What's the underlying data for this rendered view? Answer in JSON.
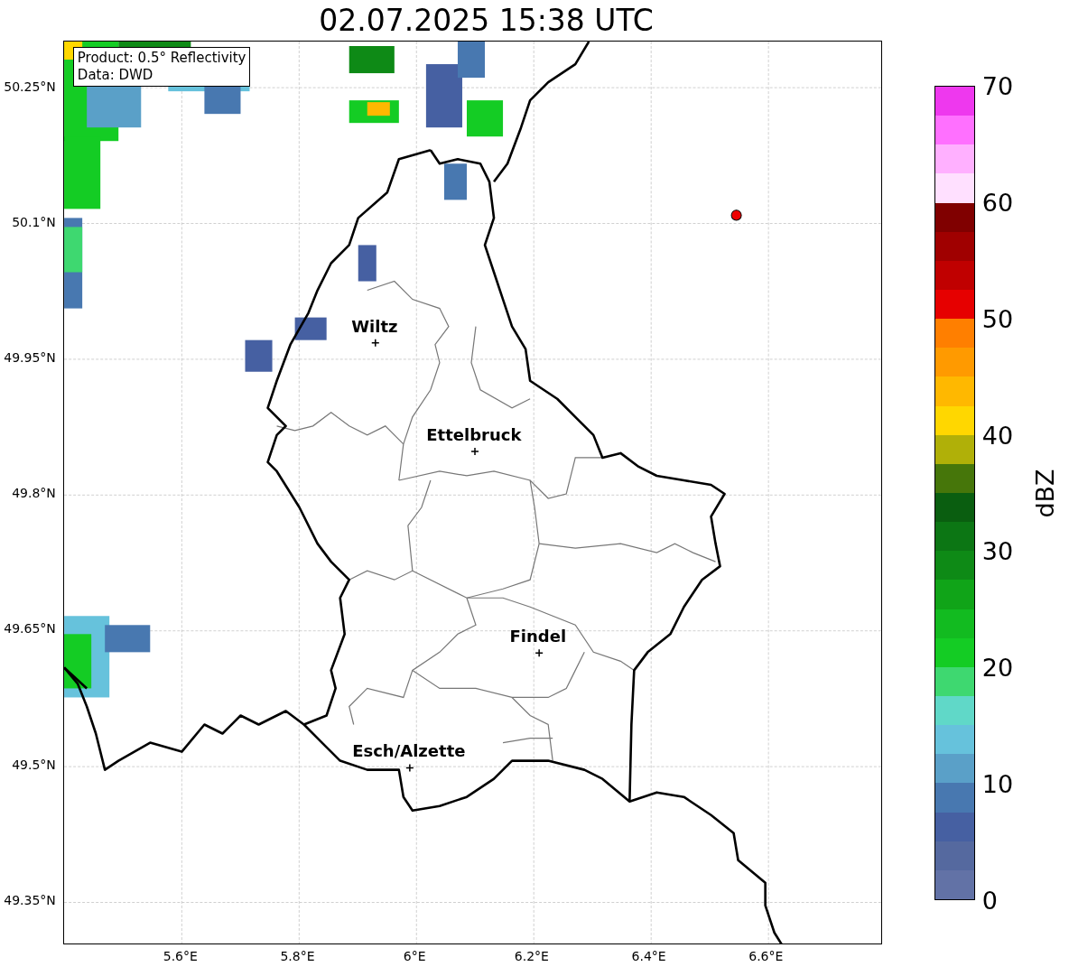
{
  "title": "02.07.2025 15:38 UTC",
  "info_box": {
    "lines": [
      "Product: 0.5° Reflectivity",
      "Data: DWD"
    ]
  },
  "map": {
    "lat_ticks": [
      "50.25°N",
      "50.1°N",
      "49.95°N",
      "49.8°N",
      "49.65°N",
      "49.5°N",
      "49.35°N"
    ],
    "lon_ticks": [
      "5.6°E",
      "5.8°E",
      "6°E",
      "6.2°E",
      "6.4°E",
      "6.6°E"
    ],
    "cities": [
      {
        "name": "Wiltz"
      },
      {
        "name": "Ettelbruck"
      },
      {
        "name": "Findel"
      },
      {
        "name": "Esch/Alzette"
      }
    ]
  },
  "colorbar": {
    "label": "dBZ",
    "ticks": [
      "70",
      "60",
      "50",
      "40",
      "30",
      "20",
      "10",
      "0"
    ],
    "bands": [
      {
        "color": "#ee38ee"
      },
      {
        "color": "#ff70ff"
      },
      {
        "color": "#ffb0ff"
      },
      {
        "color": "#ffe0ff"
      },
      {
        "color": "#800000"
      },
      {
        "color": "#a00000"
      },
      {
        "color": "#c00000"
      },
      {
        "color": "#e60000"
      },
      {
        "color": "#ff7f00"
      },
      {
        "color": "#ff9a00"
      },
      {
        "color": "#ffb800"
      },
      {
        "color": "#ffd700"
      },
      {
        "color": "#b0b008"
      },
      {
        "color": "#46760a"
      },
      {
        "color": "#0a5e10"
      },
      {
        "color": "#0c7614"
      },
      {
        "color": "#0e8a16"
      },
      {
        "color": "#10a418"
      },
      {
        "color": "#12bb20"
      },
      {
        "color": "#14cc24"
      },
      {
        "color": "#3ed870"
      },
      {
        "color": "#60d8c8"
      },
      {
        "color": "#66c2dc"
      },
      {
        "color": "#5aa0c8"
      },
      {
        "color": "#4878b0"
      },
      {
        "color": "#4660a2"
      },
      {
        "color": "#55699f"
      },
      {
        "color": "#6272a6"
      }
    ]
  }
}
